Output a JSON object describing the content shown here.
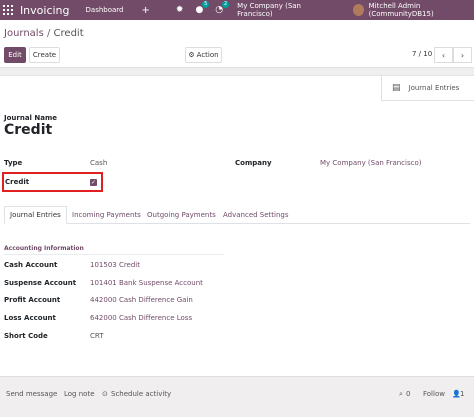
{
  "navbar": {
    "app_name": "Invoicing",
    "menu_dashboard": "Dashboard",
    "plus": "+",
    "chat_badge": "5",
    "activity_badge": "2",
    "company": "My Company (San Francisco)",
    "user": "Mitchell Admin (CommunityDB15)"
  },
  "breadcrumb": {
    "parent": "Journals",
    "separator": "/",
    "current": "Credit"
  },
  "toolbar": {
    "edit": "Edit",
    "create": "Create",
    "action": "Action"
  },
  "pager": {
    "value": "7 / 10",
    "prev": "‹",
    "next": "›"
  },
  "smart_button": {
    "label": "Journal Entries"
  },
  "form": {
    "journal_name_label": "Journal Name",
    "journal_name": "Credit",
    "type_label": "Type",
    "type_value": "Cash",
    "credit_label": "Credit",
    "credit_checked": true,
    "company_label": "Company",
    "company_value": "My Company (San Francisco)"
  },
  "tabs": [
    {
      "label": "Journal Entries",
      "active": true
    },
    {
      "label": "Incoming Payments"
    },
    {
      "label": "Outgoing Payments"
    },
    {
      "label": "Advanced Settings"
    }
  ],
  "accounting": {
    "section_title": "Accounting Information",
    "fields": [
      {
        "label": "Cash Account",
        "value": "101503 Credit"
      },
      {
        "label": "Suspense Account",
        "value": "101401 Bank Suspense Account"
      },
      {
        "label": "Profit Account",
        "value": "442000 Cash Difference Gain"
      },
      {
        "label": "Loss Account",
        "value": "642000 Cash Difference Loss"
      },
      {
        "label": "Short Code",
        "value": "CRT"
      }
    ]
  },
  "chatter": {
    "send_message": "Send message",
    "log_note": "Log note",
    "schedule_activity": "Schedule activity",
    "attachments": "0",
    "follow": "Follow",
    "followers": "1"
  },
  "colors": {
    "brand": "#714b67",
    "highlight_border": "#e02020"
  }
}
